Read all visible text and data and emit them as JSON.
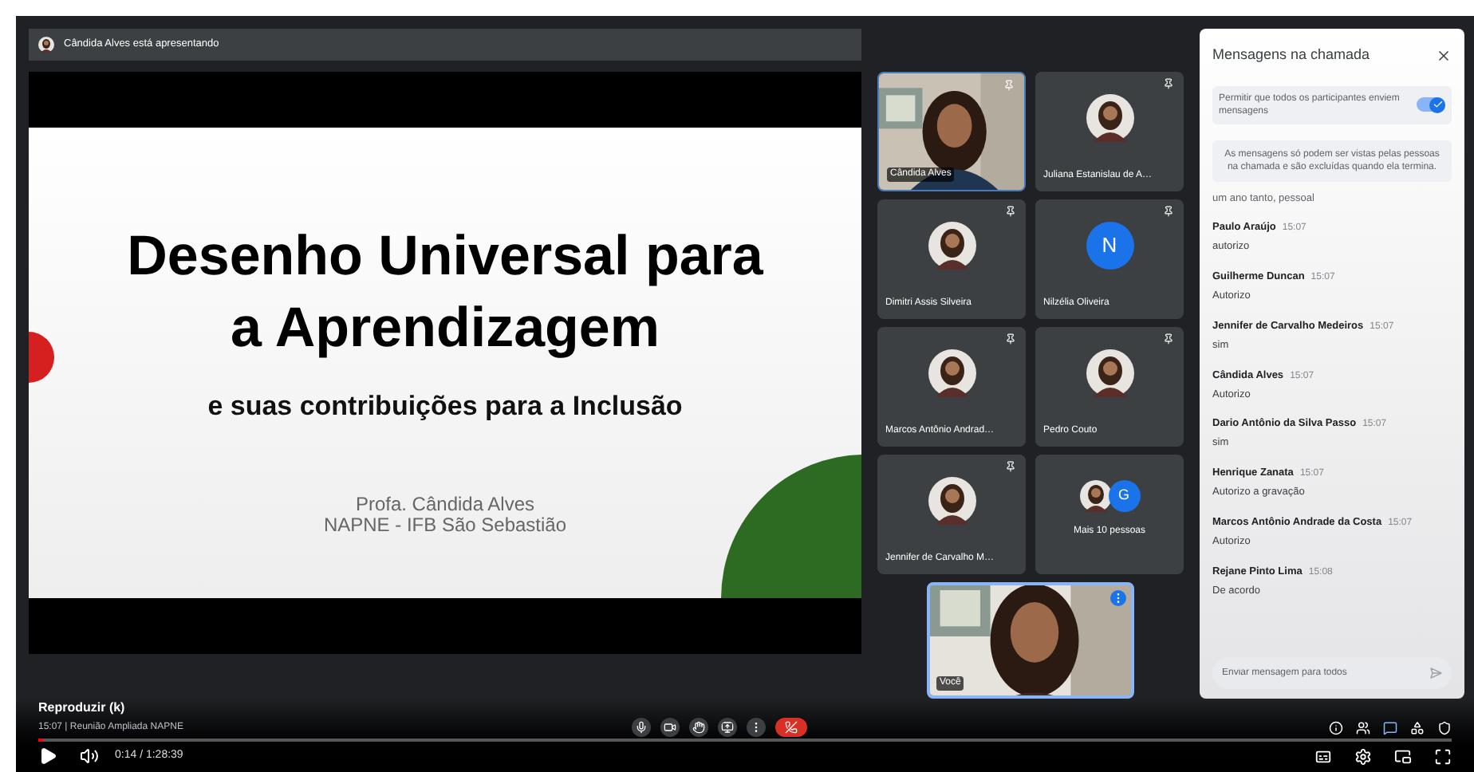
{
  "presenter_bar": {
    "text": "Cândida Alves está apresentando"
  },
  "slide": {
    "title": "Desenho Universal para a Aprendizagem",
    "subtitle": "e suas contribuições para a Inclusão",
    "author": "Profa. Cândida Alves",
    "affiliation": "NAPNE - IFB São Sebastião"
  },
  "tiles": [
    {
      "name": "Cândida Alves",
      "kind": "video"
    },
    {
      "name": "Juliana Estanislau de A…"
    },
    {
      "name": "Dimitri Assis Silveira"
    },
    {
      "name": "Nilzélia Oliveira",
      "kind": "letter",
      "letter": "N"
    },
    {
      "name": "Marcos Antônio Andrad…"
    },
    {
      "name": "Pedro Couto"
    },
    {
      "name": "Jennifer de Carvalho M…"
    },
    {
      "name": "Mais 10 pessoas",
      "kind": "more",
      "letter": "G"
    }
  ],
  "self_tile": {
    "name": "Você"
  },
  "chat": {
    "title": "Mensagens na chamada",
    "toggle": {
      "label": "Permitir que todos os participantes enviem mensagens",
      "on": true
    },
    "notice": "As mensagens só podem ser vistas pelas pessoas na chamada e são excluídas quando ela termina.",
    "messages": [
      {
        "kind": "continuation",
        "text": "um ano tanto, pessoal"
      },
      {
        "kind": "message",
        "sender": "Paulo Araújo",
        "time": "15:07",
        "text": "autorizo"
      },
      {
        "kind": "message",
        "sender": "Guilherme Duncan",
        "time": "15:07",
        "text": "Autorizo"
      },
      {
        "kind": "message",
        "sender": "Jennifer de Carvalho Medeiros",
        "time": "15:07",
        "text": "sim"
      },
      {
        "kind": "message",
        "sender": "Cândida Alves",
        "time": "15:07",
        "text": "Autorizo"
      },
      {
        "kind": "message",
        "sender": "Dario Antônio da Silva Passo",
        "time": "15:07",
        "text": "sim"
      },
      {
        "kind": "message",
        "sender": "Henrique Zanata",
        "time": "15:07",
        "text": "Autorizo a gravação"
      },
      {
        "kind": "message",
        "sender": "Marcos Antônio Andrade da Costa",
        "time": "15:07",
        "text": "Autorizo"
      },
      {
        "kind": "message",
        "sender": "Rejane Pinto Lima",
        "time": "15:08",
        "text": "De acordo"
      }
    ],
    "input": {
      "placeholder": "Enviar mensagem para todos"
    }
  },
  "player": {
    "tooltip": "Reproduzir (k)",
    "meeting_info": "15:07 | Reunião Ampliada NAPNE",
    "time": "0:14 / 1:28:39",
    "progress": {
      "level": 0.003
    }
  }
}
